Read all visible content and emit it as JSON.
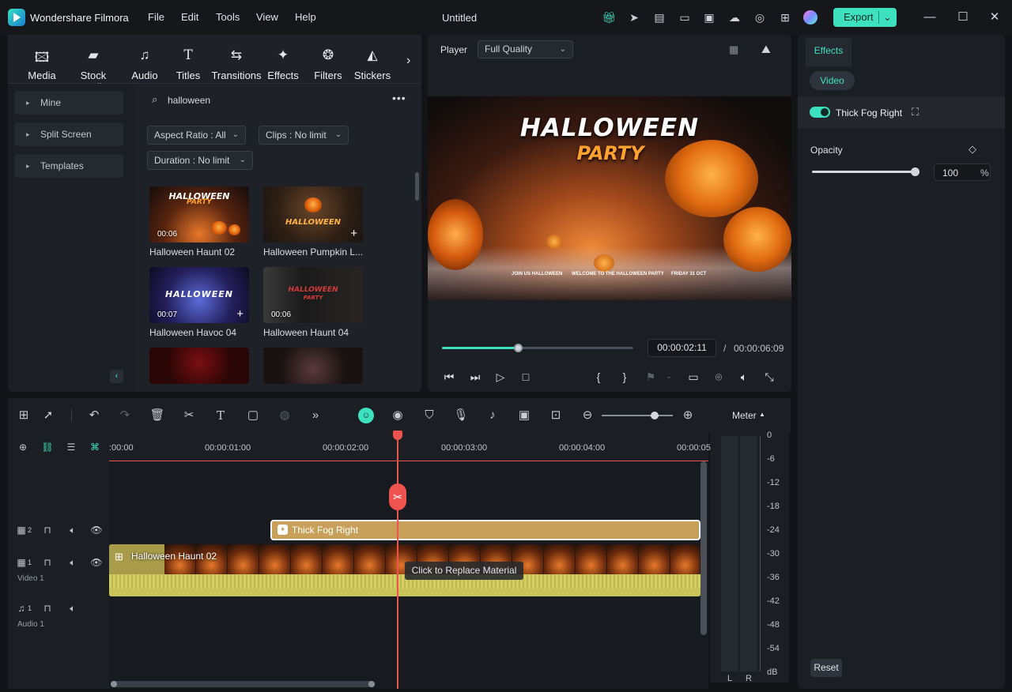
{
  "app": {
    "name": "Wondershare Filmora",
    "doc_title": "Untitled",
    "export_label": "Export"
  },
  "menu": [
    "File",
    "Edit",
    "Tools",
    "View",
    "Help"
  ],
  "toolbar": [
    "Media",
    "Stock Media",
    "Audio",
    "Titles",
    "Transitions",
    "Effects",
    "Filters",
    "Stickers"
  ],
  "sidebar": [
    "Mine",
    "Split Screen",
    "Templates"
  ],
  "search": {
    "value": "halloween"
  },
  "filters": {
    "aspect": "Aspect Ratio : All",
    "clips": "Clips : No limit",
    "duration": "Duration : No limit"
  },
  "media": [
    {
      "name": "Halloween Haunt 02",
      "duration": "00:06",
      "thumb_text": "HALLOWEEN",
      "thumb_sub": "PARTY"
    },
    {
      "name": "Halloween Pumpkin L...",
      "duration": "",
      "thumb_text": "HALLOWEEN",
      "thumb_sub": ""
    },
    {
      "name": "Halloween Havoc 04",
      "duration": "00:07",
      "thumb_text": "HALLOWEEN",
      "thumb_sub": ""
    },
    {
      "name": "Halloween Haunt 04",
      "duration": "00:06",
      "thumb_text": "HALLOWEEN",
      "thumb_sub": "PARTY"
    }
  ],
  "player": {
    "label": "Player",
    "quality": "Full Quality",
    "title": "HALLOWEEN",
    "subtitle": "PARTY",
    "current": "00:00:02:11",
    "separator": "/",
    "total": "00:00:06:09",
    "progress": 0.4,
    "bottom_text": [
      "JOIN US HALLOWEEN",
      "WELCOME TO THE HALLOWEEN PARTY",
      "FRIDAY 31 OCT"
    ]
  },
  "effects": {
    "tab": "Effects",
    "subtab": "Video",
    "effect_name": "Thick Fog Right",
    "opacity_label": "Opacity",
    "opacity_value": "100",
    "opacity_unit": "%",
    "opacity_fraction": 1.0,
    "reset": "Reset"
  },
  "timeline": {
    "ticks": [
      ":00:00",
      "00:00:01:00",
      "00:00:02:00",
      "00:00:03:00",
      "00:00:04:00",
      "00:00:05"
    ],
    "effect_clip": "Thick Fog Right",
    "video_clip": "Halloween Haunt 02",
    "replace_tip": "Click to Replace Material",
    "track_video_num": "1",
    "track_video_label": "Video 1",
    "track_fx_num": "2",
    "track_audio_num": "1",
    "track_audio_label": "Audio 1",
    "playhead_time_fraction": 0.4
  },
  "meter": {
    "label": "Meter",
    "db": [
      "0",
      "-6",
      "-12",
      "-18",
      "-24",
      "-30",
      "-36",
      "-42",
      "-48",
      "-54",
      "dB"
    ],
    "left": "L",
    "right": "R"
  },
  "colors": {
    "accent": "#3ee1bf",
    "playhead": "#ef5350",
    "effect_clip": "#c9a05a",
    "audio_wave": "#d4cf62"
  }
}
